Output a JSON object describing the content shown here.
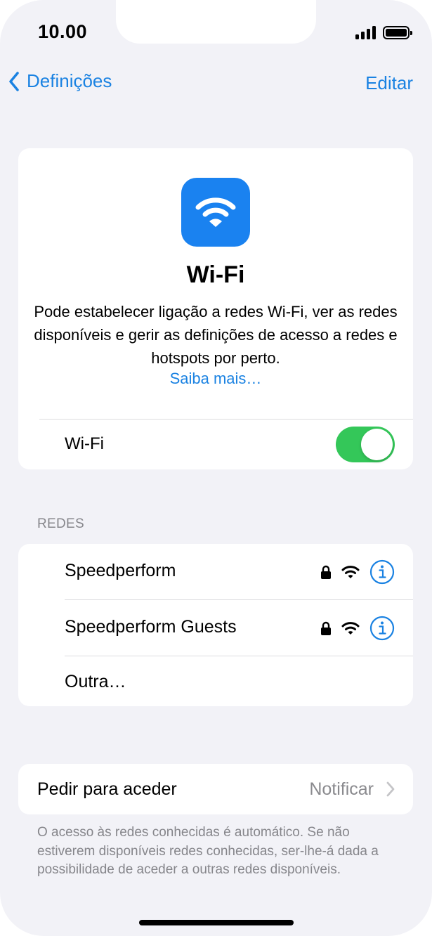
{
  "status_bar": {
    "time": "10.00"
  },
  "nav": {
    "back_label": "Definições",
    "edit_label": "Editar"
  },
  "hero": {
    "title": "Wi-Fi",
    "description": "Pode estabelecer ligação a redes Wi-Fi, ver as redes disponíveis e gerir as definições de acesso a redes e hotspots por perto.",
    "learn_more": "Saiba mais…",
    "toggle_label": "Wi-Fi",
    "toggle_on": true
  },
  "networks": {
    "header": "REDES",
    "items": [
      {
        "name": "Speedperform",
        "locked": true,
        "icon": "wifi-icon"
      },
      {
        "name": "Speedperform Guests",
        "locked": true,
        "icon": "wifi-icon"
      }
    ],
    "other_label": "Outra…"
  },
  "ask_to_join": {
    "label": "Pedir para aceder",
    "value": "Notificar",
    "footnote": "O acesso às redes conhecidas é automático. Se não estiverem disponíveis redes conhecidas, ser-lhe-á dada a possibilidade de aceder a outras redes disponíveis."
  },
  "colors": {
    "accent": "#1a82e2",
    "toggle_on": "#34c759",
    "background": "#f2f2f7",
    "secondary_text": "#86868b"
  }
}
